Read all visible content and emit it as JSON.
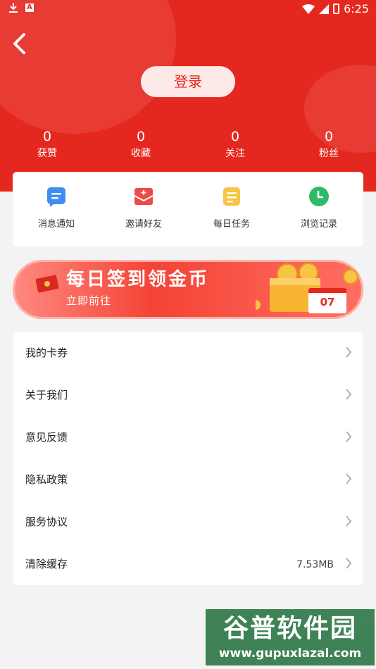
{
  "status_bar": {
    "time": "6:25",
    "notif_a": "A",
    "icons": [
      "download-icon",
      "a-notification-icon",
      "wifi-icon",
      "signal-icon",
      "battery-icon"
    ]
  },
  "header": {
    "login_label": "登录",
    "background": "#e5281f"
  },
  "stats": [
    {
      "value": "0",
      "label": "获赞"
    },
    {
      "value": "0",
      "label": "收藏"
    },
    {
      "value": "0",
      "label": "关注"
    },
    {
      "value": "0",
      "label": "粉丝"
    }
  ],
  "quick_actions": [
    {
      "label": "消息通知",
      "icon": "message-icon"
    },
    {
      "label": "邀请好友",
      "icon": "invite-envelope-icon"
    },
    {
      "label": "每日任务",
      "icon": "task-note-icon"
    },
    {
      "label": "浏览记录",
      "icon": "clock-icon"
    }
  ],
  "banner": {
    "title": "每日签到领金币",
    "subtitle": "立即前往",
    "calendar_day": "07"
  },
  "menu": [
    {
      "label": "我的卡券",
      "value": ""
    },
    {
      "label": "关于我们",
      "value": ""
    },
    {
      "label": "意见反馈",
      "value": ""
    },
    {
      "label": "隐私政策",
      "value": ""
    },
    {
      "label": "服务协议",
      "value": ""
    },
    {
      "label": "清除缓存",
      "value": "7.53MB"
    }
  ],
  "watermark": {
    "name": "谷普软件园",
    "url": "www.gupuxlazal.com"
  }
}
